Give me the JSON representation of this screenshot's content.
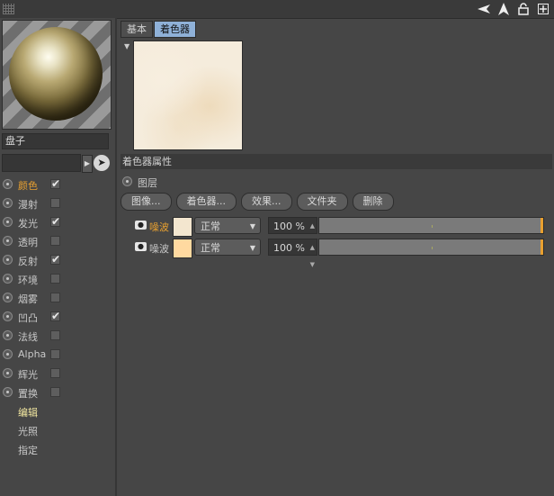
{
  "topbar": {
    "icons": [
      "arrow-left-icon",
      "arrow-up-icon",
      "lock-icon",
      "add-icon"
    ]
  },
  "left_panel": {
    "material_name": "盘子",
    "search_value": "",
    "channels": [
      {
        "label": "颜色",
        "checked": true,
        "active": true
      },
      {
        "label": "漫射",
        "checked": false,
        "active": false
      },
      {
        "label": "发光",
        "checked": true,
        "active": false
      },
      {
        "label": "透明",
        "checked": false,
        "active": false
      },
      {
        "label": "反射",
        "checked": true,
        "active": false
      },
      {
        "label": "环境",
        "checked": false,
        "active": false
      },
      {
        "label": "烟雾",
        "checked": false,
        "active": false
      },
      {
        "label": "凹凸",
        "checked": true,
        "active": false
      },
      {
        "label": "法线",
        "checked": false,
        "active": false
      },
      {
        "label": "Alpha",
        "checked": false,
        "active": false
      },
      {
        "label": "辉光",
        "checked": false,
        "active": false
      },
      {
        "label": "置换",
        "checked": false,
        "active": false
      }
    ],
    "sub_items": [
      {
        "label": "编辑",
        "active": true
      },
      {
        "label": "光照",
        "active": false
      },
      {
        "label": "指定",
        "active": false
      }
    ]
  },
  "right_panel": {
    "tabs": [
      {
        "label": "基本",
        "active": false
      },
      {
        "label": "着色器",
        "active": true
      }
    ],
    "section_title": "着色器属性",
    "layer_radio_label": "图层",
    "buttons": [
      "图像...",
      "着色器...",
      "效果...",
      "文件夹",
      "删除"
    ],
    "layers": [
      {
        "name": "噪波",
        "active": true,
        "mode": "正常",
        "percent": "100 %",
        "opacity_fraction": 1.0
      },
      {
        "name": "噪波",
        "active": false,
        "mode": "正常",
        "percent": "100 %",
        "opacity_fraction": 1.0
      }
    ]
  },
  "colors": {
    "accent_active": "#e8a030",
    "tab_active": "#8fb1d8",
    "sub_active": "#f2e7a0"
  }
}
